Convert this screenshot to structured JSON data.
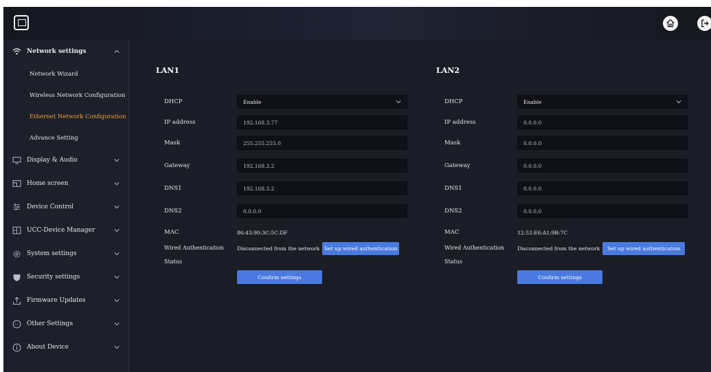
{
  "header": {
    "logo_icon": "screen-share-icon",
    "home_icon": "home-icon",
    "logout_icon": "logout-icon"
  },
  "sidebar": {
    "groups": [
      {
        "label": "Network settings",
        "icon": "wifi-icon",
        "expanded": true,
        "items": [
          {
            "label": "Network Wizard"
          },
          {
            "label": "Wireless Network Configuration"
          },
          {
            "label": "Ethernet Network Configuration",
            "active": true
          },
          {
            "label": "Advance Setting"
          }
        ]
      },
      {
        "label": "Display & Audio",
        "icon": "monitor-icon"
      },
      {
        "label": "Home screen",
        "icon": "home-screen-icon"
      },
      {
        "label": "Device Control",
        "icon": "sliders-icon"
      },
      {
        "label": "UCC-Device Manager",
        "icon": "device-manager-icon"
      },
      {
        "label": "System settings",
        "icon": "gear-icon"
      },
      {
        "label": "Security settings",
        "icon": "shield-icon"
      },
      {
        "label": "Firmware Updates",
        "icon": "upload-icon"
      },
      {
        "label": "Other Settings",
        "icon": "more-icon"
      },
      {
        "label": "About Device",
        "icon": "info-icon"
      }
    ]
  },
  "labels": {
    "dhcp": "DHCP",
    "ip": "IP address",
    "mask": "Mask",
    "gateway": "Gateway",
    "dns1": "DNS1",
    "dns2": "DNS2",
    "mac": "MAC",
    "auth_line1": "Wired Authentication",
    "auth_line2": "Status",
    "setup_auth": "Set up wired authentication",
    "confirm": "Confirm settings"
  },
  "lan1": {
    "title": "LAN1",
    "dhcp": "Enable",
    "ip": "192.168.3.77",
    "mask": "255.255.255.0",
    "gateway": "192.168.3.2",
    "dns1": "192.168.3.2",
    "dns2": "0.0.0.0",
    "mac": "86:43:90:3C:5C:DF",
    "auth_status": "Disconnected from the network"
  },
  "lan2": {
    "title": "LAN2",
    "dhcp": "Enable",
    "ip": "0.0.0.0",
    "mask": "0.0.0.0",
    "gateway": "0.0.0.0",
    "dns1": "0.0.0.0",
    "dns2": "0.0.0.0",
    "mac": "12:52:E6:A1:9B:7C",
    "auth_status": "Disconnected from the network"
  },
  "colors": {
    "accent": "#4a7ae0",
    "active_nav": "#f2a23a",
    "background": "#1a1d26"
  }
}
